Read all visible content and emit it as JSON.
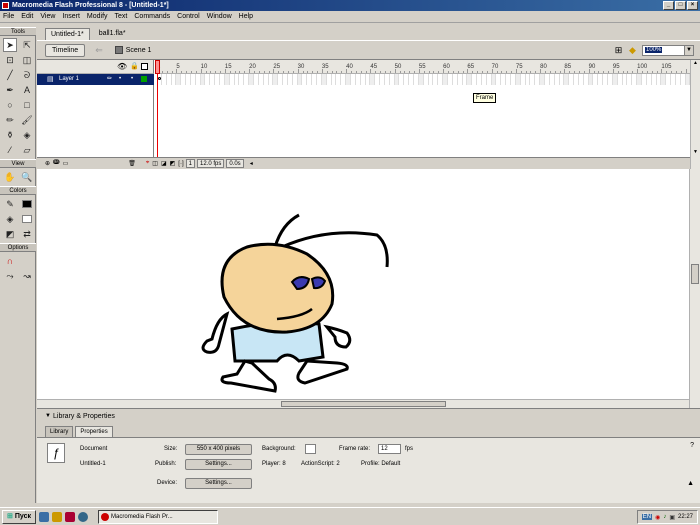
{
  "window": {
    "title": "Macromedia Flash Professional 8 - [Untitled-1*]"
  },
  "menu": [
    "File",
    "Edit",
    "View",
    "Insert",
    "Modify",
    "Text",
    "Commands",
    "Control",
    "Window",
    "Help"
  ],
  "tools": {
    "title": "Tools",
    "view_label": "View",
    "colors_label": "Colors",
    "options_label": "Options"
  },
  "doc_tabs": [
    "Untitled-1*",
    "ball1.fla*"
  ],
  "timeline_header": {
    "timeline_label": "Timeline",
    "scene_label": "Scene 1",
    "zoom": "100%"
  },
  "ruler_ticks": [
    "1",
    "5",
    "10",
    "15",
    "20",
    "25",
    "30",
    "35",
    "40",
    "45",
    "50",
    "55",
    "60",
    "65",
    "70",
    "75",
    "80",
    "85",
    "90",
    "95",
    "100",
    "105"
  ],
  "layer": {
    "name": "Layer 1"
  },
  "tooltip": "Frame",
  "timeline_status": {
    "frame": "1",
    "fps": "12.0 fps",
    "time": "0.0s"
  },
  "panels": {
    "bar_title": "Library & Properties",
    "tabs": [
      "Library",
      "Properties"
    ]
  },
  "properties": {
    "doc_type": "Document",
    "doc_name": "Untitled-1",
    "size_label": "Size:",
    "size_value": "550 x 400 pixels",
    "background_label": "Background:",
    "framerate_label": "Frame rate:",
    "framerate_value": "12",
    "fps_unit": "fps",
    "publish_label": "Publish:",
    "settings_label": "Settings...",
    "player_label": "Player: 8",
    "actionscript_label": "ActionScript: 2",
    "profile_label": "Profile: Default",
    "device_label": "Device:",
    "device_settings_label": "Settings..."
  },
  "taskbar": {
    "start_label": "Пуск",
    "app_label": "Macromedia Flash Pr...",
    "lang": "EN",
    "clock": "22:27"
  },
  "colors": {
    "accent": "#0a246a",
    "face": "#f5d49a",
    "shorts": "#c8e6f5",
    "eyes": "#3a3ab0"
  }
}
